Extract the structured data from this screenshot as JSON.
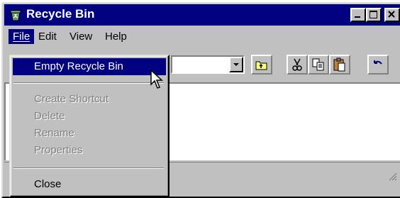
{
  "window": {
    "title": "Recycle Bin"
  },
  "menubar": {
    "items": [
      {
        "label": "File"
      },
      {
        "label": "Edit"
      },
      {
        "label": "View"
      },
      {
        "label": "Help"
      }
    ]
  },
  "file_menu": {
    "empty_recycle_bin": "Empty Recycle Bin",
    "create_shortcut": "Create Shortcut",
    "delete": "Delete",
    "rename": "Rename",
    "properties": "Properties",
    "close": "Close"
  },
  "icons": {
    "app": "recycle-bin-icon",
    "minimize": "minimize-icon",
    "maximize": "maximize-icon",
    "close": "close-icon",
    "up_folder": "up-folder-icon",
    "cut": "cut-icon",
    "copy": "copy-icon",
    "paste": "paste-icon",
    "undo": "undo-icon"
  },
  "colors": {
    "titlebar": "#000080",
    "highlight": "#000080",
    "face": "#c0c0c0"
  }
}
